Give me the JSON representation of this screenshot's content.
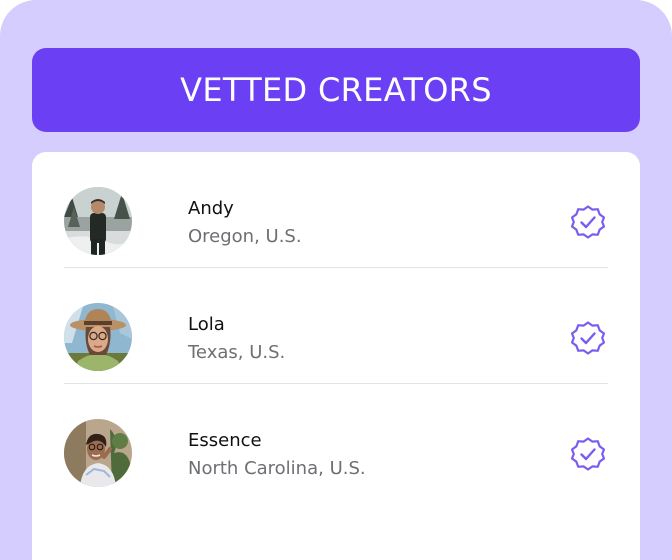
{
  "header": {
    "title": "VETTED CREATORS"
  },
  "creators": [
    {
      "name": "Andy",
      "location": "Oregon, U.S.",
      "avatar": "photo-man-in-forest",
      "badge": "verified-badge-icon"
    },
    {
      "name": "Lola",
      "location": "Texas, U.S.",
      "avatar": "photo-woman-in-hat",
      "badge": "verified-badge-icon"
    },
    {
      "name": "Essence",
      "location": "North Carolina, U.S.",
      "avatar": "photo-woman-with-plants",
      "badge": "verified-badge-icon"
    }
  ],
  "colors": {
    "background": "#d5cdfd",
    "header": "#6b40f5",
    "badge": "#7b5cf0",
    "name": "#111111",
    "location": "#6e6e74"
  }
}
